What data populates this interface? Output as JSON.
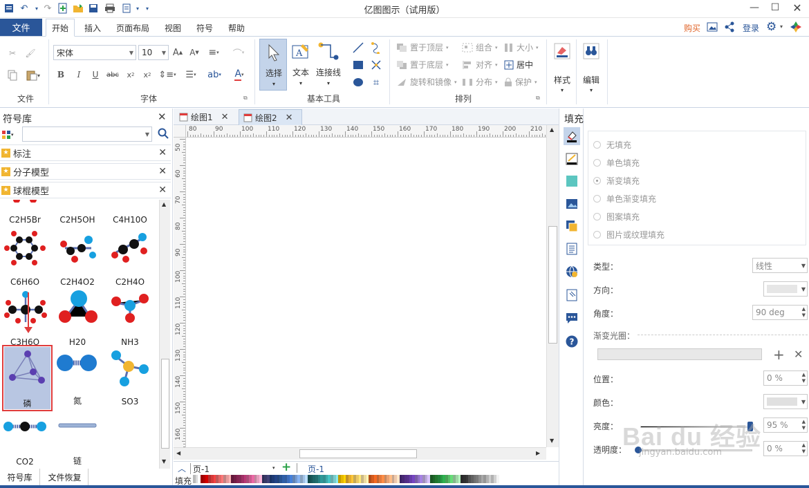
{
  "app": {
    "title": "亿图图示（试用版）"
  },
  "colors": {
    "accent": "#2a5699",
    "selection": "#e03c3c",
    "selectedBg": "#b8c6e2",
    "tabActive": "#dbe6f4"
  },
  "menu": {
    "file": "文件",
    "tabs": [
      "开始",
      "插入",
      "页面布局",
      "视图",
      "符号",
      "帮助"
    ],
    "buy": "购买",
    "login": "登录"
  },
  "ribbon": {
    "groups": {
      "file": "文件",
      "font": "字体",
      "basic_tools": "基本工具",
      "arrange": "排列"
    },
    "font_name": "宋体",
    "font_size": "10",
    "select": "选择",
    "text": "文本",
    "connector": "连接线",
    "arrange_items": {
      "bring_front": "置于顶层",
      "send_back": "置于底层",
      "rotate": "旋转和镜像",
      "group": "组合",
      "align": "对齐",
      "distribute": "分布",
      "size": "大小",
      "center": "居中",
      "protect": "保护"
    },
    "style": "样式",
    "edit": "编辑"
  },
  "library": {
    "title": "符号库",
    "search_placeholder": "",
    "categories": [
      "标注",
      "分子模型",
      "球棍模型"
    ],
    "symbols": [
      {
        "label": "C2H5Br"
      },
      {
        "label": "C2H5OH"
      },
      {
        "label": "C4H10O"
      },
      {
        "label": "C6H6O"
      },
      {
        "label": "C2H4O2"
      },
      {
        "label": "C2H4O"
      },
      {
        "label": "C3H6O"
      },
      {
        "label": "H20"
      },
      {
        "label": "NH3"
      },
      {
        "label": "磷"
      },
      {
        "label": "氮"
      },
      {
        "label": "SO3"
      },
      {
        "label": "CO2"
      },
      {
        "label": "链"
      }
    ],
    "bottom_tabs": [
      "符号库",
      "文件恢复"
    ]
  },
  "documents": {
    "tabs": [
      "绘图1",
      "绘图2"
    ],
    "active": "绘图2"
  },
  "ruler": {
    "h": [
      "80",
      "90",
      "100",
      "110",
      "120",
      "130",
      "140",
      "150",
      "160",
      "170",
      "180",
      "190",
      "200",
      "210"
    ],
    "v": [
      "50",
      "60",
      "70",
      "80",
      "90",
      "100",
      "110",
      "120",
      "130",
      "140",
      "150",
      "160"
    ]
  },
  "pages": {
    "selector": "页-1",
    "current": "页-1",
    "fill_label": "填充"
  },
  "fill_panel": {
    "title": "填充",
    "options": [
      "无填充",
      "单色填充",
      "渐变填充",
      "单色渐变填充",
      "图案填充",
      "图片或纹理填充"
    ],
    "selected": "渐变填充",
    "type_label": "类型：",
    "type_value": "线性",
    "direction_label": "方向：",
    "angle_label": "角度：",
    "angle_value": "90 deg",
    "gradient_label": "渐变光圈：",
    "position_label": "位置：",
    "position_value": "0 %",
    "color_label": "颜色：",
    "brightness_label": "亮度：",
    "brightness_value": "95 %",
    "transparency_label": "透明度：",
    "transparency_value": "0 %"
  },
  "watermark": {
    "text": "Bai du 经验",
    "url": "jingyan.baidu.com"
  }
}
